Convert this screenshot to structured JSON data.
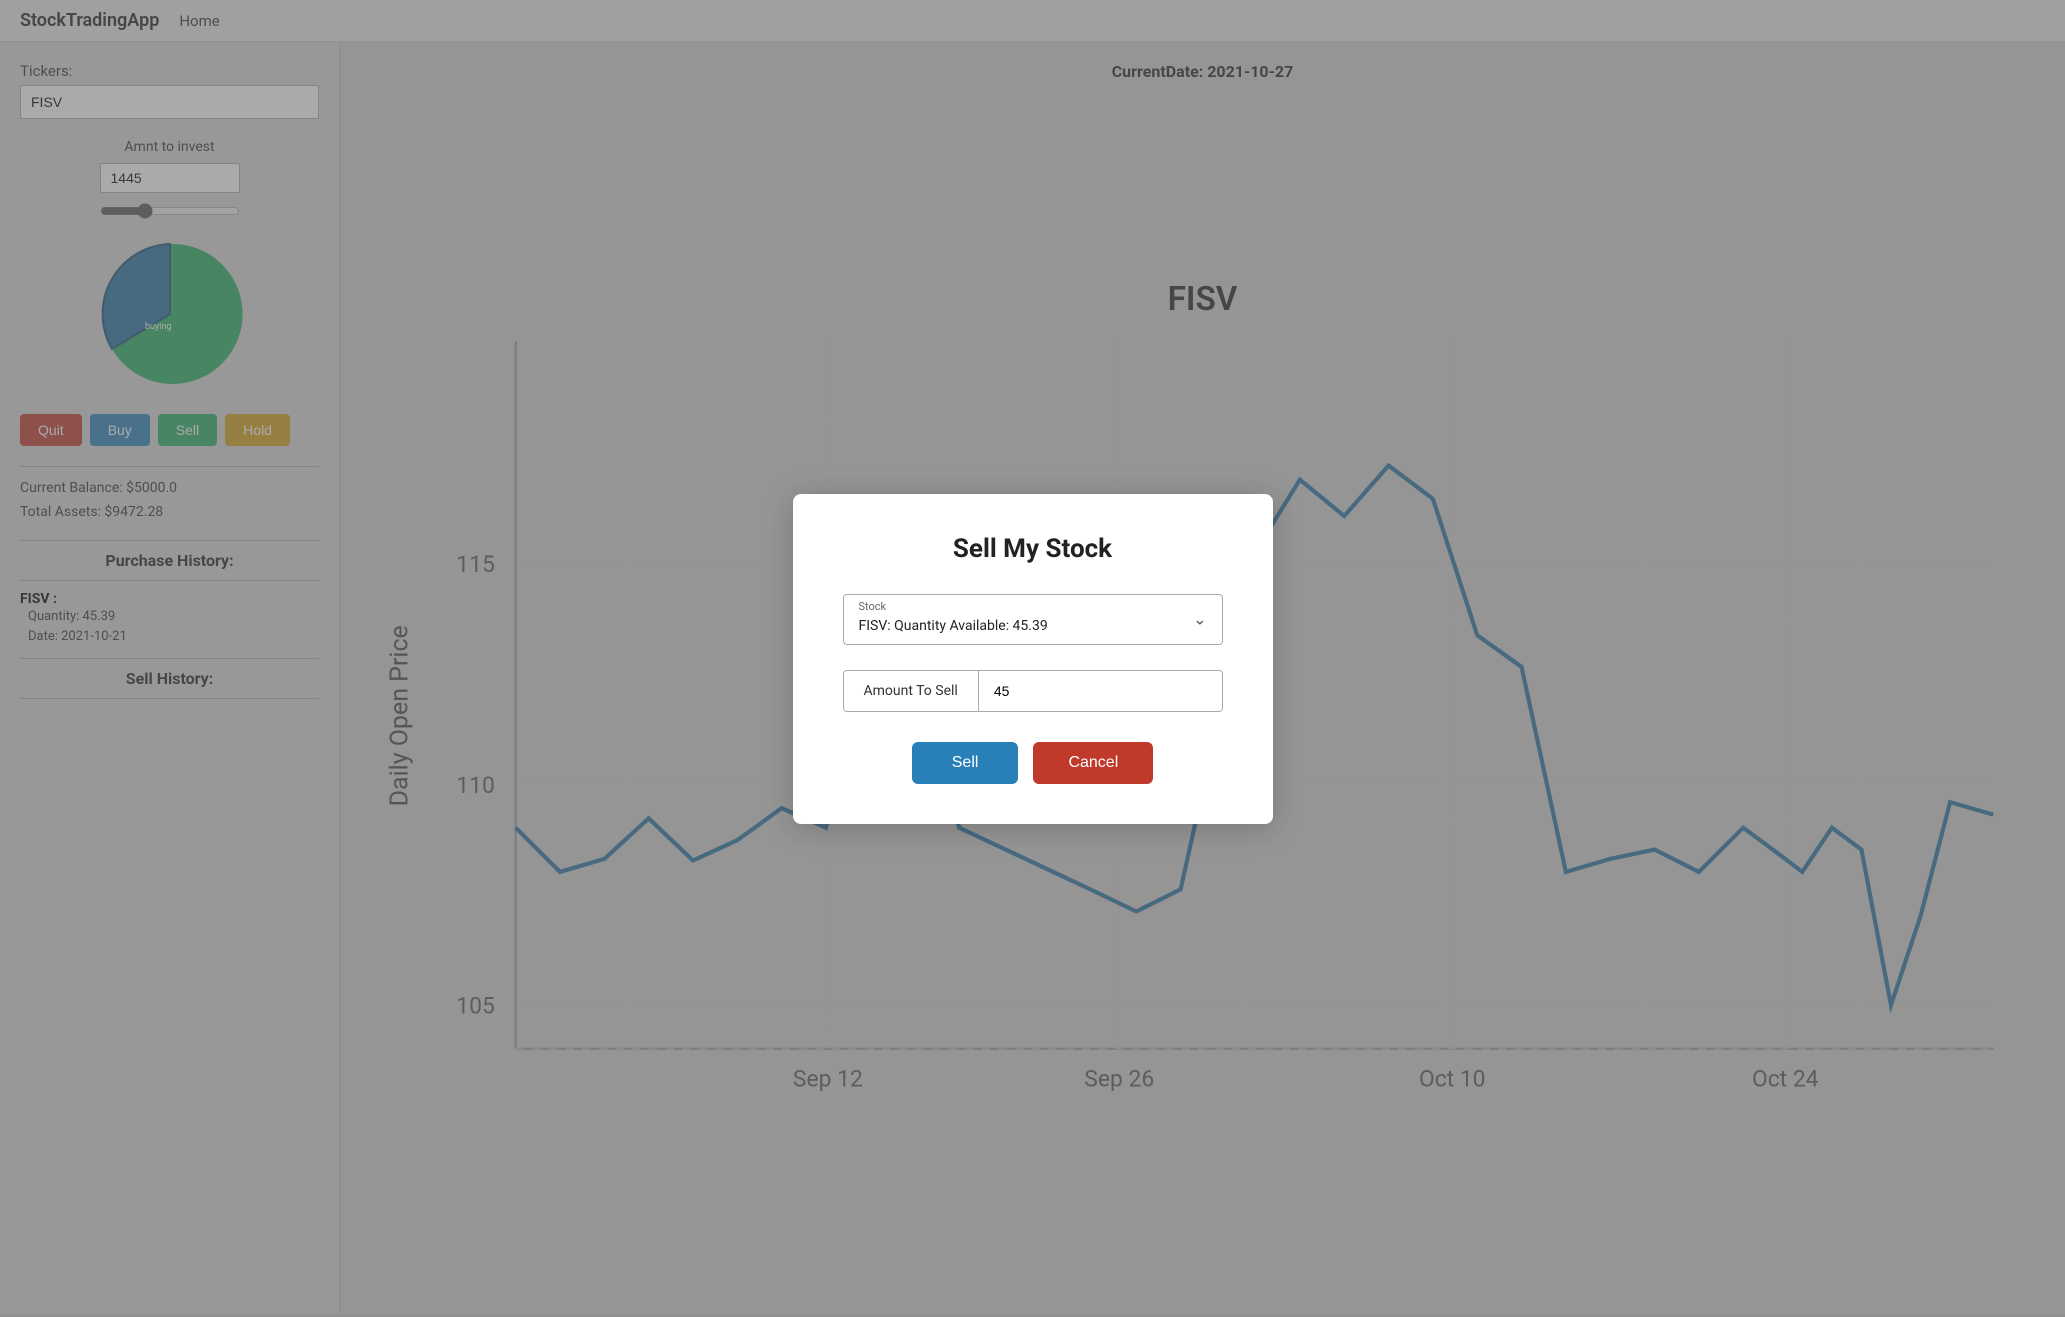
{
  "app": {
    "brand": "StockTradingApp",
    "nav_home": "Home"
  },
  "sidebar": {
    "tickers_label": "Tickers:",
    "tickers_value": "FISV",
    "amnt_label": "Amnt to invest",
    "amnt_value": "1445",
    "slider_value": 30,
    "buttons": {
      "quit": "Quit",
      "buy": "Buy",
      "sell": "Sell",
      "hold": "Hold"
    },
    "balance": {
      "current": "Current Balance: $5000.0",
      "total": "Total Assets:   $9472.28"
    },
    "purchase_history_title": "Purchase History:",
    "purchase_items": [
      {
        "name": "FISV :",
        "quantity": "Quantity: 45.39",
        "date": "Date: 2021-10-21"
      }
    ],
    "sell_history_title": "Sell History:"
  },
  "chart": {
    "current_date_label": "CurrentDate: 2021-10-27",
    "stock_name": "FISV",
    "y_axis_label": "Daily Open Price",
    "x_labels": [
      "Sep 12",
      "Sep 26",
      "Oct 10",
      "Oct 24"
    ],
    "y_ticks": [
      105,
      110,
      115
    ],
    "data_points": [
      {
        "x": 0.0,
        "y": 109.5
      },
      {
        "x": 0.03,
        "y": 109.0
      },
      {
        "x": 0.06,
        "y": 109.3
      },
      {
        "x": 0.09,
        "y": 110.2
      },
      {
        "x": 0.12,
        "y": 109.2
      },
      {
        "x": 0.15,
        "y": 109.8
      },
      {
        "x": 0.18,
        "y": 110.5
      },
      {
        "x": 0.21,
        "y": 110.0
      },
      {
        "x": 0.24,
        "y": 115.2
      },
      {
        "x": 0.27,
        "y": 114.5
      },
      {
        "x": 0.3,
        "y": 110.0
      },
      {
        "x": 0.33,
        "y": 109.5
      },
      {
        "x": 0.36,
        "y": 109.0
      },
      {
        "x": 0.39,
        "y": 108.5
      },
      {
        "x": 0.42,
        "y": 108.0
      },
      {
        "x": 0.45,
        "y": 108.3
      },
      {
        "x": 0.5,
        "y": 116.5
      },
      {
        "x": 0.53,
        "y": 118.0
      },
      {
        "x": 0.56,
        "y": 117.2
      },
      {
        "x": 0.59,
        "y": 118.5
      },
      {
        "x": 0.62,
        "y": 117.8
      },
      {
        "x": 0.65,
        "y": 114.5
      },
      {
        "x": 0.68,
        "y": 113.8
      },
      {
        "x": 0.71,
        "y": 108.5
      },
      {
        "x": 0.74,
        "y": 108.8
      },
      {
        "x": 0.77,
        "y": 109.0
      },
      {
        "x": 0.79,
        "y": 108.0
      },
      {
        "x": 0.81,
        "y": 109.5
      },
      {
        "x": 0.83,
        "y": 109.0
      },
      {
        "x": 0.85,
        "y": 108.5
      },
      {
        "x": 0.87,
        "y": 110.0
      },
      {
        "x": 0.89,
        "y": 109.5
      },
      {
        "x": 0.91,
        "y": 104.5
      },
      {
        "x": 0.93,
        "y": 107.0
      },
      {
        "x": 0.96,
        "y": 110.8
      },
      {
        "x": 1.0,
        "y": 110.5
      }
    ]
  },
  "modal": {
    "title": "Sell My Stock",
    "stock_dropdown_label": "Stock",
    "stock_dropdown_value": "FISV: Quantity Available: 45.39",
    "amount_label": "Amount To Sell",
    "amount_value": "45",
    "sell_button": "Sell",
    "cancel_button": "Cancel"
  }
}
